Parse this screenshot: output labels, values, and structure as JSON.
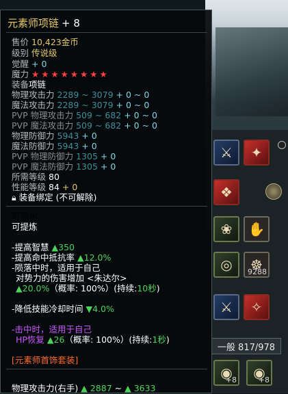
{
  "item": {
    "name": "元素师项链",
    "enhance": "+ 8"
  },
  "stats": {
    "price_label": "售价",
    "price_value": "10,423金币",
    "level_label": "级别",
    "level_value": "传说级",
    "awaken_label": "觉醒",
    "awaken_value": "+ 0",
    "magic_label": "魔力",
    "magic_stars": "★★★★★★★★",
    "equip_label": "装备",
    "equip_value": "项链",
    "phys_atk_label": "物理攻击力",
    "phys_atk_range": "2289 ~ 3079",
    "phys_atk_bonus": "+ 0 ~ 0",
    "mag_atk_label": "魔法攻击力",
    "mag_atk_range": "2289 ~ 3079",
    "mag_atk_bonus": "+ 0 ~ 0",
    "pvp_phys_atk_label": "PVP 物理攻击力",
    "pvp_phys_atk_range": "509 ~ 682",
    "pvp_phys_atk_bonus": "+ 0 ~ 0",
    "pvp_mag_atk_label": "PVP 魔法攻击力",
    "pvp_mag_atk_range": "509 ~ 682",
    "pvp_mag_atk_bonus": "+ 0 ~ 0",
    "phys_def_label": "物理防御力",
    "phys_def_value": "5943",
    "phys_def_bonus": "+ 0",
    "mag_def_label": "魔法防御力",
    "mag_def_value": "5943",
    "mag_def_bonus": "+ 0",
    "pvp_phys_def_label": "PVP 物理防御力",
    "pvp_phys_def_value": "1305",
    "pvp_phys_def_bonus": "+ 0",
    "pvp_mag_def_label": "PVP 魔法防御力",
    "pvp_mag_def_value": "1305",
    "pvp_mag_def_bonus": "+ 0",
    "req_level_label": "所需等级",
    "req_level_value": "80",
    "perf_level_label": "性能等级",
    "perf_level_value": "84",
    "perf_level_bonus": "+ 0",
    "bind_text": "装备绑定 (不可解除)"
  },
  "props": {
    "enhanceable": "可强化",
    "refinable": "可提炼"
  },
  "effects": {
    "e1_label": "-提高智慧",
    "e1_value": "▲350",
    "e2_label": "-提高命中抵抗率",
    "e2_value": "▲12.0%",
    "e3_label": "-陨落中时，适用于自己",
    "e4_label": "对势力的伤害增加 <朱达尔>",
    "e5_value": "▲20.0%",
    "e5_chance": "（概率: 100%）(持续:",
    "e5_dur": "10秒",
    "e5_close": ")",
    "e6_label": "-降低技能冷却时间",
    "e6_value": "▼4.0%",
    "e7_label": "-击中时，适用于自己",
    "e8_label": "HP恢复",
    "e8_value": "▲26",
    "e8_chance": "（概率: 100%）(持续:",
    "e8_dur": "1秒",
    "e8_close": ")"
  },
  "set_name": "[元素师首饰套装]",
  "bottom": {
    "label": "物理攻击力(右手)",
    "v1": "▲ 2887",
    "sep": "~",
    "v2": "▲ 3633"
  },
  "inventory": {
    "tab_label": "一般 817/978",
    "stack_count": "9288",
    "count_a": "+8",
    "count_b": "+8"
  }
}
